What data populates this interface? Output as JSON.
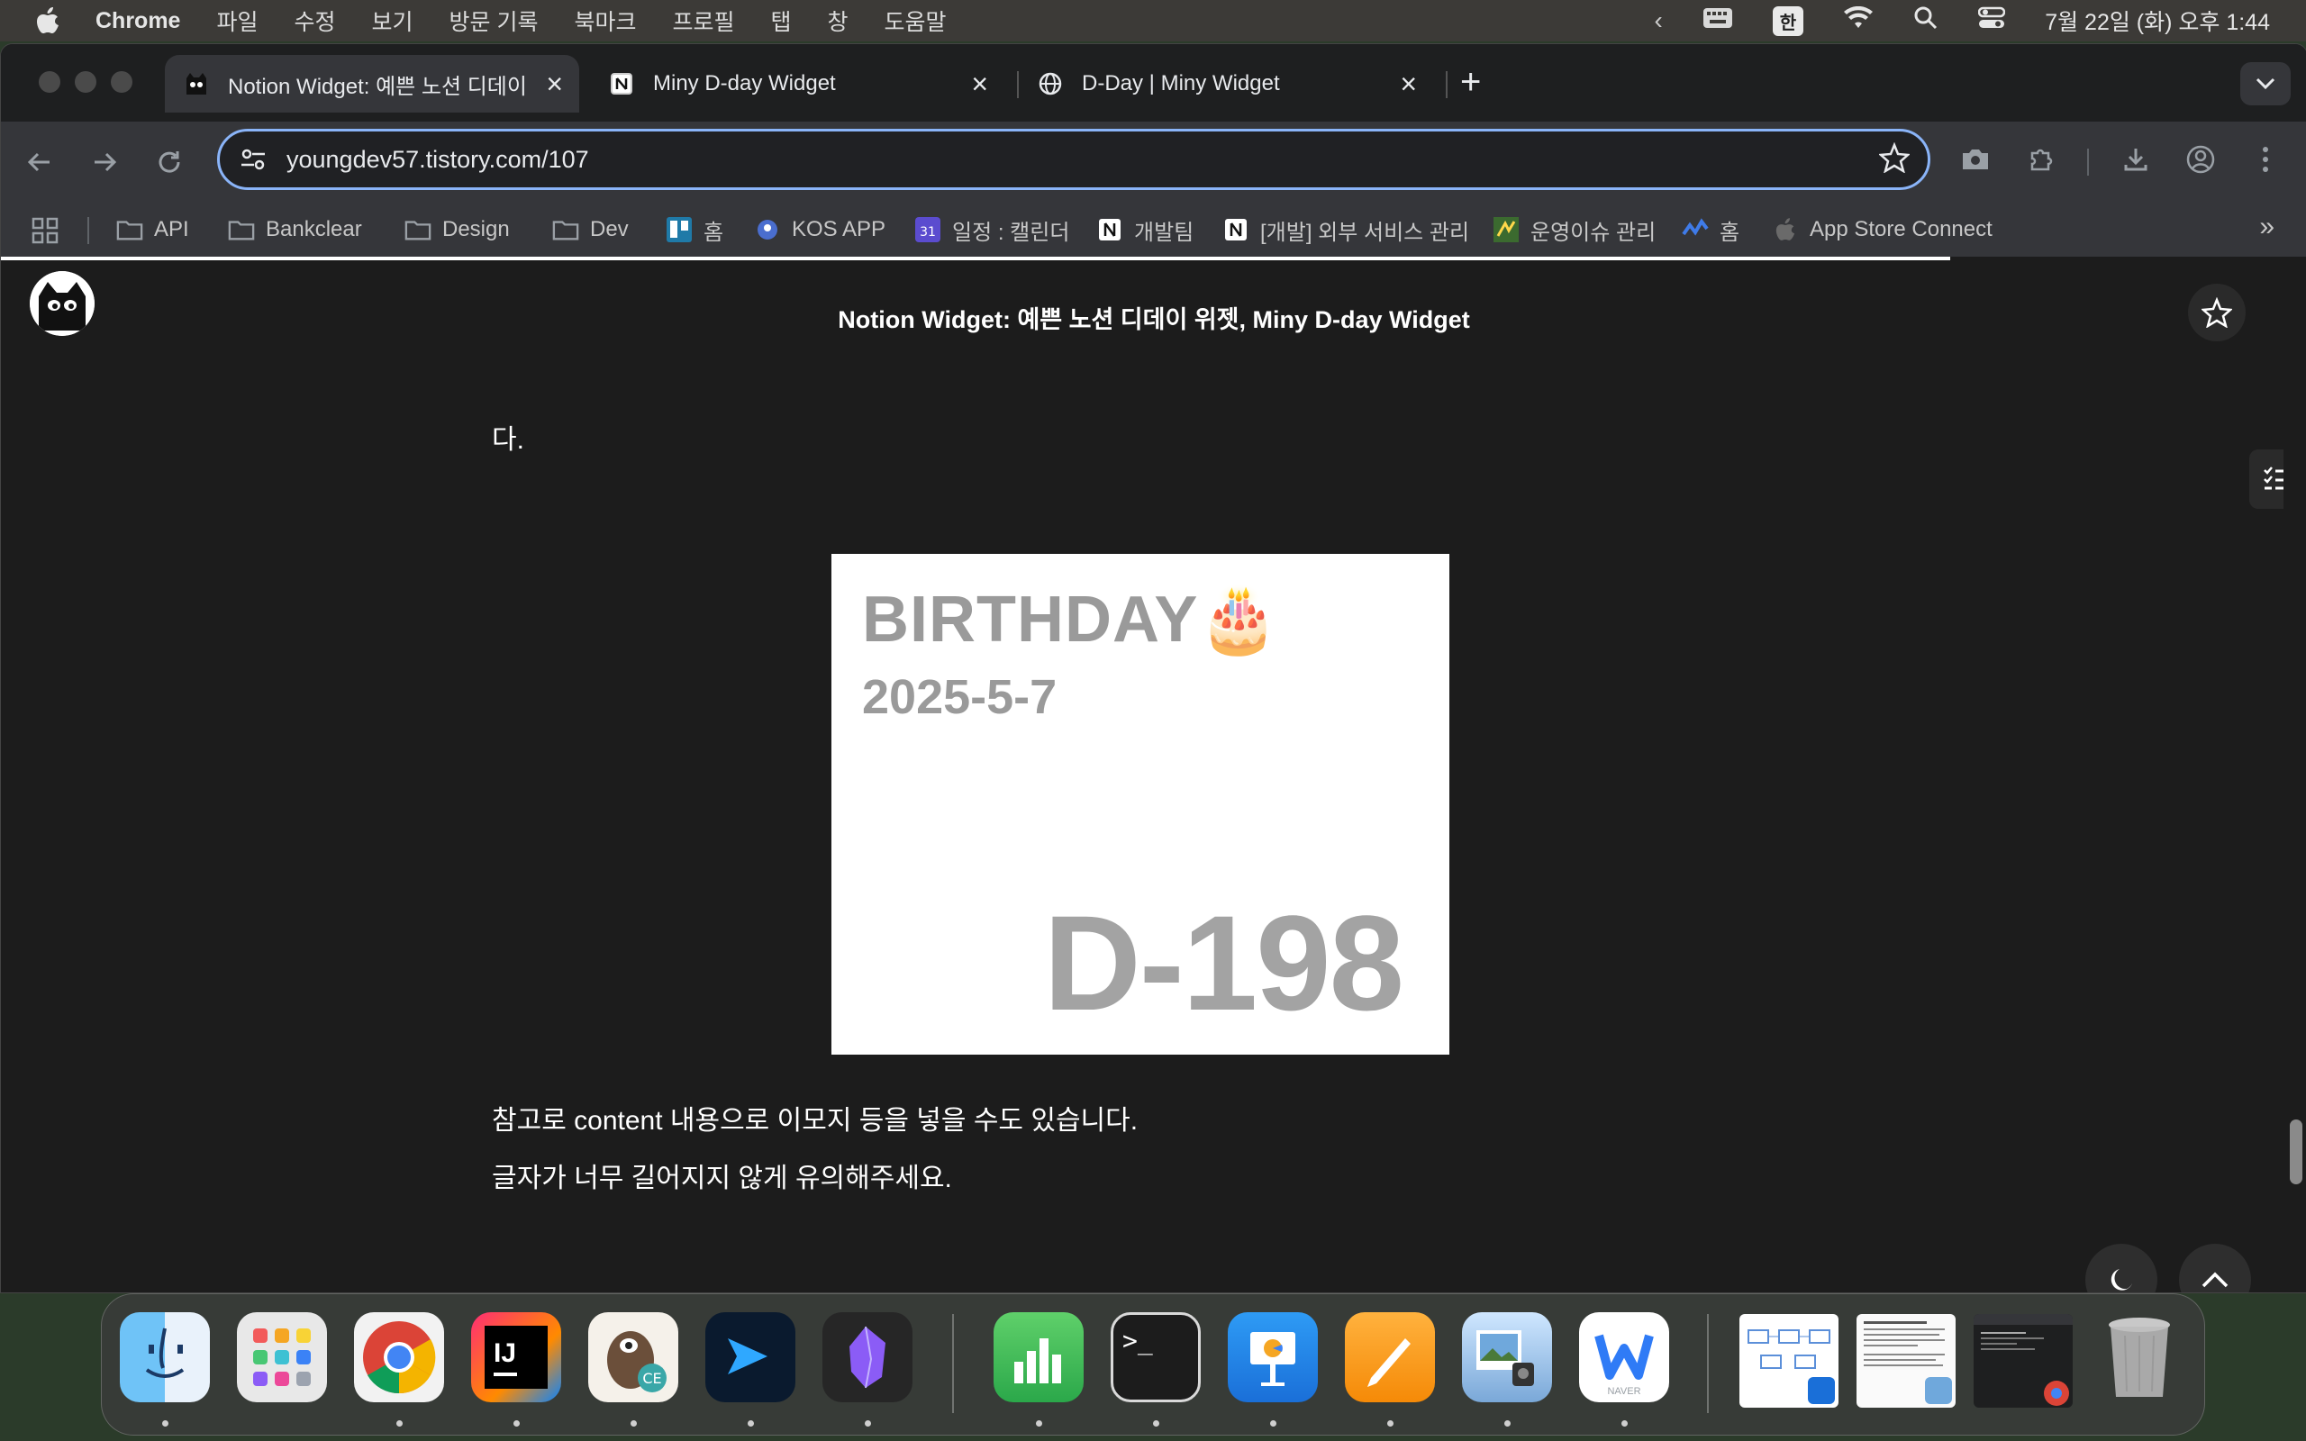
{
  "menubar": {
    "app_name": "Chrome",
    "menus": [
      "파일",
      "수정",
      "보기",
      "방문 기록",
      "북마크",
      "프로필",
      "탭",
      "창",
      "도움말"
    ],
    "input_method": "한",
    "datetime": "7월 22일 (화) 오후 1:44"
  },
  "tabs": [
    {
      "title": "Notion Widget: 예쁜 노션 디데이",
      "favicon": "cat-logo-icon",
      "active": true
    },
    {
      "title": "Miny D-day Widget",
      "favicon": "notion-icon",
      "active": false
    },
    {
      "title": "D-Day | Miny Widget",
      "favicon": "globe-icon",
      "active": false
    }
  ],
  "omnibox": {
    "url": "youngdev57.tistory.com/107"
  },
  "bookmarks": [
    {
      "label": "API",
      "icon": "folder-icon"
    },
    {
      "label": "Bankclear",
      "icon": "folder-icon"
    },
    {
      "label": "Design",
      "icon": "folder-icon"
    },
    {
      "label": "Dev",
      "icon": "folder-icon"
    },
    {
      "label": "홈",
      "icon": "trello-icon"
    },
    {
      "label": "KOS APP",
      "icon": "kos-icon"
    },
    {
      "label": "일정 : 캘린더",
      "icon": "calendar-icon"
    },
    {
      "label": "개발팀",
      "icon": "notion-icon"
    },
    {
      "label": "[개발] 외부 서비스 관리",
      "icon": "notion-icon"
    },
    {
      "label": "운영이슈 관리",
      "icon": "jira-icon"
    },
    {
      "label": "홈",
      "icon": "wave-icon"
    },
    {
      "label": "App Store Connect",
      "icon": "apple-icon"
    }
  ],
  "post": {
    "header_title": "Notion Widget: 예쁜 노션 디데이 위젯, Miny D-day Widget",
    "text_top": "다.",
    "widget": {
      "title": "BIRTHDAY🎂",
      "date": "2025-5-7",
      "dday": "D-198"
    },
    "paragraph_1": "참고로 content 내용으로 이모지 등을 넣을 수도 있습니다.",
    "paragraph_2": "글자가 너무 길어지지 않게 유의해주세요."
  },
  "dock": {
    "apps": [
      "finder-icon",
      "launchpad-icon",
      "chrome-icon",
      "intellij-icon",
      "dbeaver-icon",
      "azure-data-studio-icon",
      "obsidian-icon",
      "numbers-icon",
      "terminal-icon",
      "keynote-icon",
      "pages-icon",
      "preview-icon",
      "naver-whale-icon"
    ],
    "naver_label": "NAVER"
  },
  "colors": {
    "accent": "#8ab4f8",
    "page_bg": "#1c1c1c",
    "window_bg": "#1e1f20",
    "toolbar_bg": "#35363a"
  }
}
